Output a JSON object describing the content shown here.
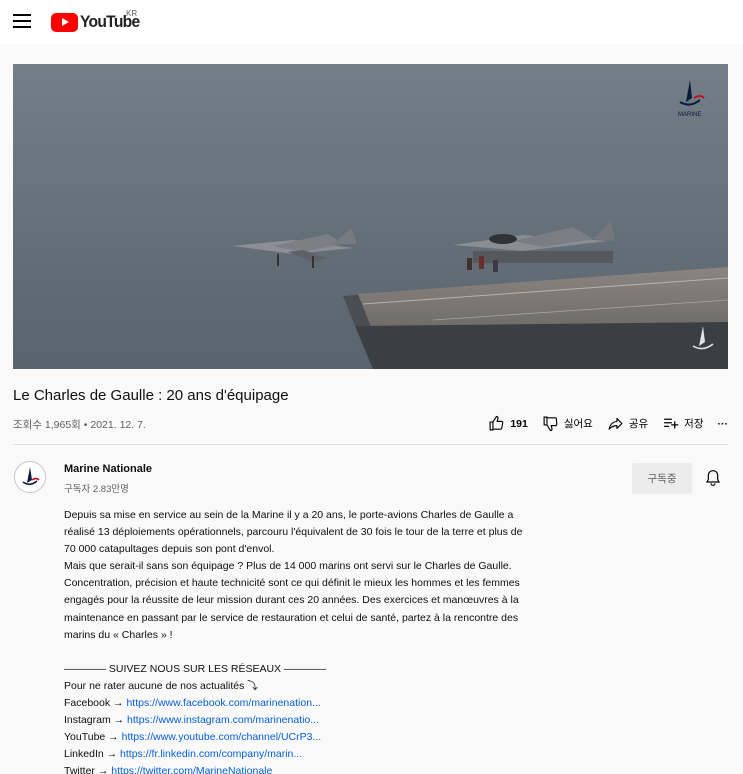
{
  "header": {
    "logo_text": "YouTube",
    "country_code": "KR"
  },
  "video": {
    "title": "Le Charles de Gaulle : 20 ans d'équipage",
    "views": "조회수 1,965회",
    "separator": "•",
    "date": "2021. 12. 7.",
    "watermark": "MARINE NATIONALE"
  },
  "actions": {
    "like_count": "191",
    "dislike_label": "싫어요",
    "share_label": "공유",
    "save_label": "저장",
    "more_label": "···"
  },
  "channel": {
    "name": "Marine Nationale",
    "subscribers": "구독자 2.83만명",
    "subscribe_label": "구독중"
  },
  "description": {
    "paragraphs": [
      "Depuis sa mise en service au sein de la Marine il y a 20 ans, le porte-avions Charles de Gaulle a",
      "réalisé 13 déploiements opérationnels, parcouru l'équivalent de 30 fois le tour de la terre et plus de",
      "70 000 catapultages depuis son pont d'envol.",
      "Mais que serait-il sans son équipage ? Plus de 14 000 marins ont servi sur le Charles de Gaulle.",
      "Concentration, précision et haute technicité sont ce qui définit le mieux les hommes et les femmes",
      "engagés pour la réussite de leur mission durant ces 20 années. Des exercices et manœuvres à la",
      "maintenance en passant par le service de restauration et celui de santé, partez à la rencontre des",
      "marins du « Charles » !"
    ],
    "social_heading": "———— SUIVEZ NOUS SUR LES RÉSEAUX ————",
    "social_intro": "Pour ne rater aucune de nos actualités ⤵",
    "links": [
      {
        "label": "Facebook →",
        "url": "https://www.facebook.com/marinenation..."
      },
      {
        "label": "Instagram →",
        "url": "https://www.instagram.com/marinenatio..."
      },
      {
        "label": "YouTube →",
        "url": "https://www.youtube.com/channel/UCrP3..."
      },
      {
        "label": "LinkedIn →",
        "url": "https://fr.linkedin.com/company/marin..."
      },
      {
        "label": "Twitter →",
        "url": "https://twitter.com/MarineNationale"
      }
    ]
  }
}
